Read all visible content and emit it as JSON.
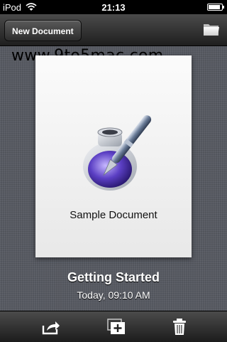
{
  "status_bar": {
    "carrier": "iPod",
    "time": "21:13",
    "battery_level": 0.9
  },
  "toolbar": {
    "new_document_label": "New Document",
    "folder_icon": "folder-icon"
  },
  "watermark": "www.9to5mac.com",
  "document": {
    "thumbnail_caption": "Sample Document",
    "title": "Getting Started",
    "modified": "Today, 09:10 AM"
  },
  "bottom_toolbar": {
    "icons": [
      "share-icon",
      "duplicate-icon",
      "trash-icon"
    ]
  },
  "colors": {
    "toolbar": "#2f2f2f",
    "linen": "#575a62",
    "card": "#f4f4f4"
  }
}
